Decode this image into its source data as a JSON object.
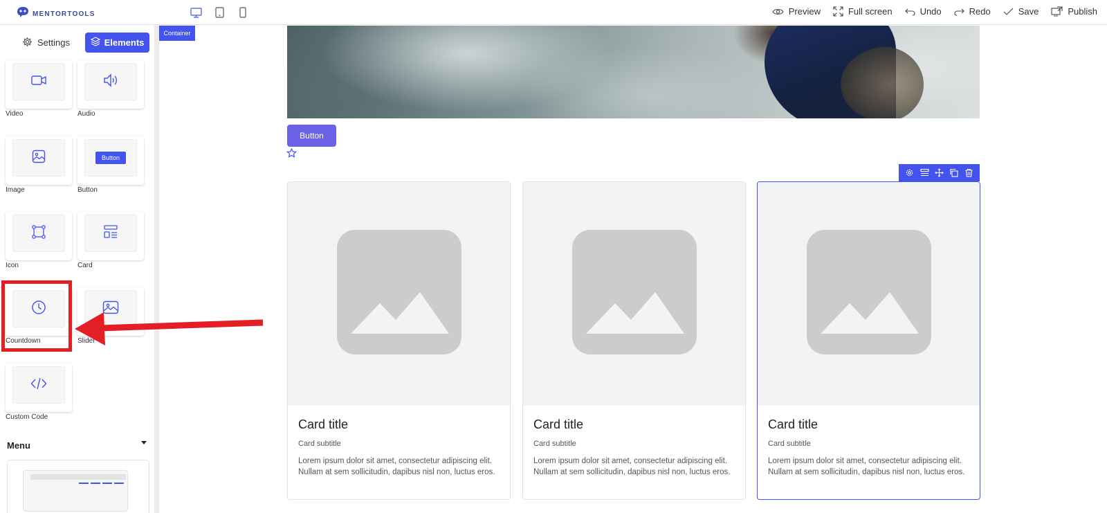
{
  "brand": {
    "name": "MENTORTOOLS"
  },
  "toolbar": {
    "preview": "Preview",
    "fullscreen": "Full screen",
    "undo": "Undo",
    "redo": "Redo",
    "save": "Save",
    "publish": "Publish"
  },
  "sidebar": {
    "tabs": {
      "settings": "Settings",
      "elements": "Elements"
    },
    "elements": [
      {
        "label": "Video",
        "icon": "video-icon"
      },
      {
        "label": "Audio",
        "icon": "audio-icon"
      },
      {
        "label": "Image",
        "icon": "image-icon"
      },
      {
        "label": "Button",
        "icon": "button-preview",
        "preview_label": "Button"
      },
      {
        "label": "Icon",
        "icon": "icon-frame-icon"
      },
      {
        "label": "Card",
        "icon": "card-layout-icon"
      },
      {
        "label": "Countdown",
        "icon": "clock-icon"
      },
      {
        "label": "Slider",
        "icon": "slider-image-icon"
      },
      {
        "label": "Custom Code",
        "icon": "code-icon"
      }
    ],
    "menu_section": {
      "label": "Menu"
    }
  },
  "canvas": {
    "container_label": "Container",
    "button_label": "Button",
    "cards": [
      {
        "title": "Card title",
        "subtitle": "Card subtitle",
        "text": "Lorem ipsum dolor sit amet, consectetur adipiscing elit. Nullam at sem sollicitudin, dapibus nisl non, luctus eros."
      },
      {
        "title": "Card title",
        "subtitle": "Card subtitle",
        "text": "Lorem ipsum dolor sit amet, consectetur adipiscing elit. Nullam at sem sollicitudin, dapibus nisl non, luctus eros."
      },
      {
        "title": "Card title",
        "subtitle": "Card subtitle",
        "text": "Lorem ipsum dolor sit amet, consectetur adipiscing elit. Nullam at sem sollicitudin, dapibus nisl non, luctus eros."
      }
    ]
  },
  "colors": {
    "accent": "#4353ee",
    "page_button": "#6b62e8",
    "highlight": "#e41e25",
    "placeholder": "#cccccc"
  }
}
